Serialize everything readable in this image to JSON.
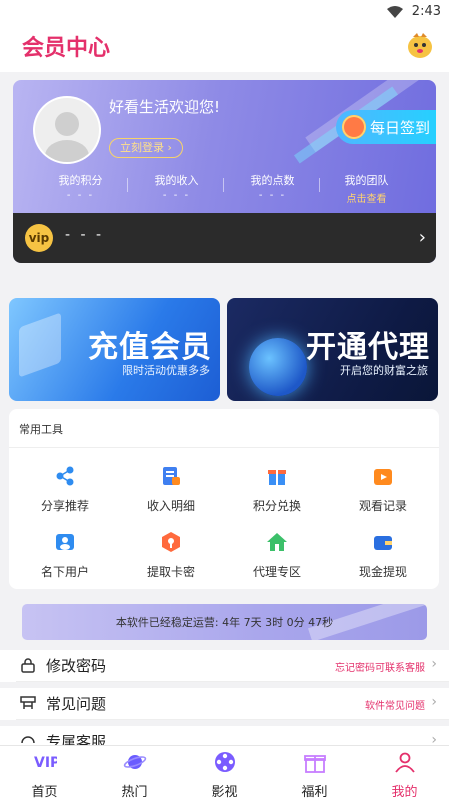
{
  "status": {
    "time": "2:43"
  },
  "header": {
    "title": "会员中心"
  },
  "member": {
    "welcome": "好看生活欢迎您!",
    "login_label": "立刻登录 ›",
    "checkin_label": "每日签到",
    "stats": [
      {
        "name": "我的积分",
        "value": "- - -"
      },
      {
        "name": "我的收入",
        "value": "- - -"
      },
      {
        "name": "我的点数",
        "value": "- - -"
      },
      {
        "name": "我的团队",
        "value": "点击查看"
      }
    ],
    "vip_badge": "vip",
    "vip_text": "- - -",
    "vip_arrow": "›"
  },
  "banners": [
    {
      "title": "充值会员",
      "subtitle": "限时活动优惠多多"
    },
    {
      "title": "开通代理",
      "subtitle": "开启您的财富之旅"
    }
  ],
  "tools": {
    "heading": "常用工具",
    "items": [
      {
        "label": "分享推荐",
        "icon": "share-icon",
        "color": "#2f8cf0"
      },
      {
        "label": "收入明细",
        "icon": "receipt-icon",
        "color": "#3f7ff0"
      },
      {
        "label": "积分兑换",
        "icon": "gift-icon",
        "color": "#3a8ff5"
      },
      {
        "label": "观看记录",
        "icon": "play-history-icon",
        "color": "#ff8a1e"
      },
      {
        "label": "名下用户",
        "icon": "users-icon",
        "color": "#2f8cf0"
      },
      {
        "label": "提取卡密",
        "icon": "key-icon",
        "color": "#ff6a3d"
      },
      {
        "label": "代理专区",
        "icon": "home-icon",
        "color": "#3cc06a"
      },
      {
        "label": "现金提现",
        "icon": "wallet-icon",
        "color": "#2a6fe0"
      }
    ]
  },
  "notice": {
    "text": "本软件已经稳定运营: 4年 7天 3时 0分 47秒"
  },
  "menu": [
    {
      "label": "修改密码",
      "hint": "忘记密码可联系客服",
      "icon": "lock-icon"
    },
    {
      "label": "常见问题",
      "hint": "软件常见问题",
      "icon": "question-icon"
    },
    {
      "label": "专属客服",
      "hint": "",
      "icon": "headset-icon"
    }
  ],
  "tabbar": [
    {
      "label": "首页",
      "icon": "vip-home-icon",
      "active": false
    },
    {
      "label": "热门",
      "icon": "planet-icon",
      "active": false
    },
    {
      "label": "影视",
      "icon": "film-reel-icon",
      "active": false
    },
    {
      "label": "福利",
      "icon": "gift-box-icon",
      "active": false
    },
    {
      "label": "我的",
      "icon": "user-profile-icon",
      "active": true
    }
  ],
  "colors": {
    "accent": "#e4306b",
    "card": "#8f8be6"
  }
}
